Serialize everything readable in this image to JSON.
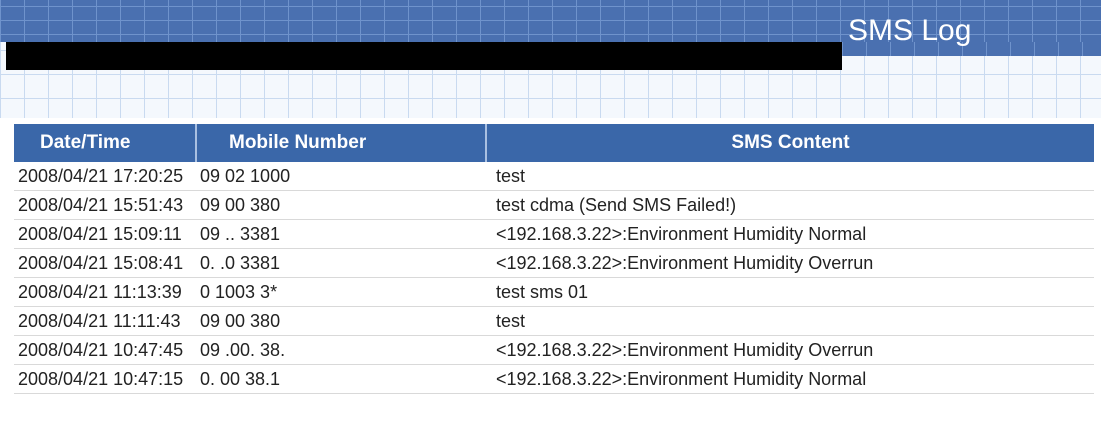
{
  "header": {
    "title": "SMS Log"
  },
  "table": {
    "columns": [
      "Date/Time",
      "Mobile Number",
      "SMS Content"
    ],
    "rows": [
      {
        "datetime": "2008/04/21 17:20:25",
        "mobile": "09  02  1000",
        "content": "test"
      },
      {
        "datetime": "2008/04/21 15:51:43",
        "mobile": "09  00  380",
        "content": "test cdma (Send SMS Failed!)"
      },
      {
        "datetime": "2008/04/21 15:09:11",
        "mobile": "09  ..  3381",
        "content": "<192.168.3.22>:Environment Humidity Normal"
      },
      {
        "datetime": "2008/04/21 15:08:41",
        "mobile": "0.  .0  3381",
        "content": "<192.168.3.22>:Environment Humidity Overrun"
      },
      {
        "datetime": "2008/04/21 11:13:39",
        "mobile": "0  1003  3*",
        "content": "test sms 01"
      },
      {
        "datetime": "2008/04/21 11:11:43",
        "mobile": "09  00  380",
        "content": "test"
      },
      {
        "datetime": "2008/04/21 10:47:45",
        "mobile": "09  .00.  38.",
        "content": "<192.168.3.22>:Environment Humidity Overrun"
      },
      {
        "datetime": "2008/04/21 10:47:15",
        "mobile": "0.  00  38.1",
        "content": "<192.168.3.22>:Environment Humidity Normal"
      }
    ]
  }
}
